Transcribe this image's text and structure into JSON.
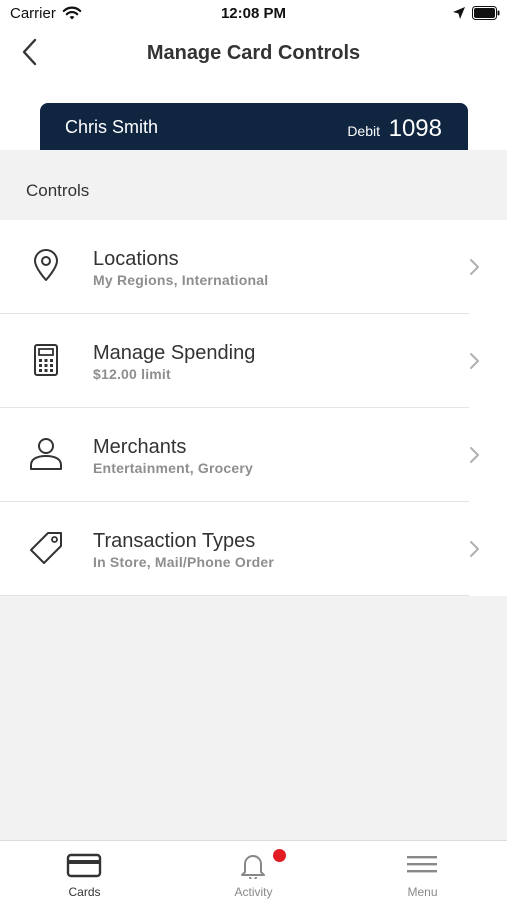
{
  "status_bar": {
    "carrier": "Carrier",
    "time": "12:08 PM"
  },
  "nav": {
    "title": "Manage Card Controls"
  },
  "card": {
    "holder": "Chris Smith",
    "type": "Debit",
    "last4": "1098",
    "color": "#0f2540"
  },
  "section": {
    "label": "Controls"
  },
  "controls": [
    {
      "title": "Locations",
      "subtitle": "My Regions, International",
      "icon": "location-pin-icon"
    },
    {
      "title": "Manage Spending",
      "subtitle": "$12.00 limit",
      "icon": "calculator-icon"
    },
    {
      "title": "Merchants",
      "subtitle": "Entertainment, Grocery",
      "icon": "person-icon"
    },
    {
      "title": "Transaction Types",
      "subtitle": "In Store, Mail/Phone Order",
      "icon": "tag-icon"
    }
  ],
  "tabs": [
    {
      "label": "Cards",
      "icon": "card-icon",
      "active": true
    },
    {
      "label": "Activity",
      "icon": "bell-icon",
      "active": false,
      "has_badge": true
    },
    {
      "label": "Menu",
      "icon": "hamburger-menu-icon",
      "active": false
    }
  ],
  "colors": {
    "badge": "#e31c23",
    "accent_dark": "#0f2540"
  }
}
